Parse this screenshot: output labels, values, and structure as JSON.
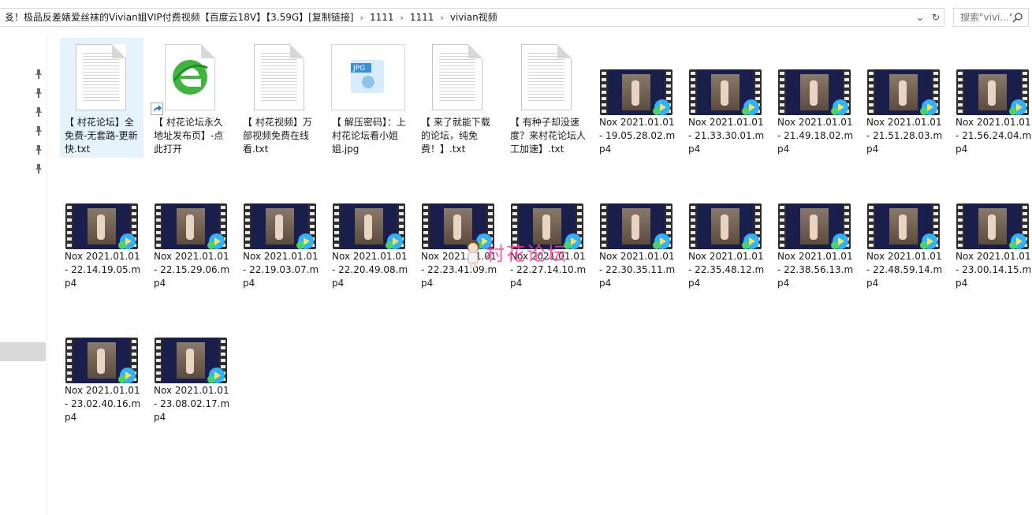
{
  "address": {
    "crumbs": [
      "㕛！极品反差婊爱丝袜的Vivian姐VIP付费视频【百度云18V】【3.59G】[复制链接]",
      "1111",
      "1111",
      "vivian视频"
    ],
    "separator": "›"
  },
  "search": {
    "placeholder": "搜索\"vivi...\""
  },
  "files": [
    {
      "type": "txt",
      "name": "【 村花论坛】全免费-无套路-更新快.txt"
    },
    {
      "type": "lnk",
      "name": "【 村花论坛永久地址发布页】-点此打开"
    },
    {
      "type": "txt",
      "name": "【 村花视频】万部视频免费在线看.txt"
    },
    {
      "type": "jpg",
      "name": "【 解压密码】：上村花论坛看小姐姐.jpg"
    },
    {
      "type": "txt",
      "name": "【 来了就能下载的论坛，纯免费！】.txt"
    },
    {
      "type": "txt",
      "name": "【 有种子却没速度？来村花论坛人工加速】.txt"
    },
    {
      "type": "mp4",
      "name": "Nox 2021.01.01 - 19.05.28.02.mp4"
    },
    {
      "type": "mp4",
      "name": "Nox 2021.01.01 - 21.33.30.01.mp4"
    },
    {
      "type": "mp4",
      "name": "Nox 2021.01.01 - 21.49.18.02.mp4"
    },
    {
      "type": "mp4",
      "name": "Nox 2021.01.01 - 21.51.28.03.mp4"
    },
    {
      "type": "mp4",
      "name": "Nox 2021.01.01 - 21.56.24.04.mp4"
    },
    {
      "type": "mp4",
      "name": "Nox 2021.01.01 - 22.14.19.05.mp4"
    },
    {
      "type": "mp4",
      "name": "Nox 2021.01.01 - 22.15.29.06.mp4"
    },
    {
      "type": "mp4",
      "name": "Nox 2021.01.01 - 22.19.03.07.mp4"
    },
    {
      "type": "mp4",
      "name": "Nox 2021.01.01 - 22.20.49.08.mp4"
    },
    {
      "type": "mp4",
      "name": "Nox 2021.01.01 - 22.23.41.09.mp4"
    },
    {
      "type": "mp4",
      "name": "Nox 2021.01.01 - 22.27.14.10.mp4"
    },
    {
      "type": "mp4",
      "name": "Nox 2021.01.01 - 22.30.35.11.mp4"
    },
    {
      "type": "mp4",
      "name": "Nox 2021.01.01 - 22.35.48.12.mp4"
    },
    {
      "type": "mp4",
      "name": "Nox 2021.01.01 - 22.38.56.13.mp4"
    },
    {
      "type": "mp4",
      "name": "Nox 2021.01.01 - 22.48.59.14.mp4"
    },
    {
      "type": "mp4",
      "name": "Nox 2021.01.01 - 23.00.14.15.mp4"
    },
    {
      "type": "mp4",
      "name": "Nox 2021.01.01 - 23.02.40.16.mp4"
    },
    {
      "type": "mp4",
      "name": "Nox 2021.01.01 - 23.08.02.17.mp4"
    }
  ],
  "watermark": {
    "text": "村花论坛"
  },
  "colors": {
    "selected": "#e5f3ff",
    "watermark": "#ff3fa0",
    "play": "#2fb3ff"
  }
}
